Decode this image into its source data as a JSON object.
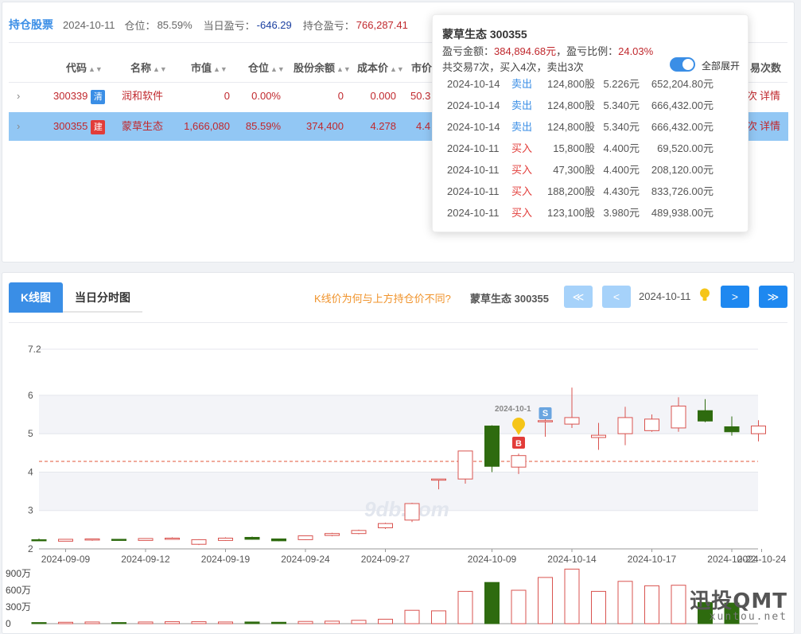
{
  "summary": {
    "title": "持仓股票",
    "date": "2024-10-11",
    "position_label": "仓位：",
    "position_value": "85.59%",
    "daily_pl_label": "当日盈亏：",
    "daily_pl_value": "-646.29",
    "hold_pl_label": "持仓盈亏：",
    "hold_pl_value": "766,287.41"
  },
  "table": {
    "headers": {
      "code": "代码",
      "name": "名称",
      "mktval": "市值",
      "pos": "仓位",
      "shares": "股份余额",
      "cost": "成本价",
      "price": "市价",
      "trades": "易次数"
    },
    "rows": [
      {
        "expand": "›",
        "code": "300339",
        "tag": "清",
        "name": "润和软件",
        "mktval": "0",
        "pos": "0.00%",
        "shares": "0",
        "cost": "0.000",
        "price": "50.3",
        "x": "次",
        "detail": "详情"
      },
      {
        "expand": "›",
        "code": "300355",
        "tag": "建",
        "name": "蒙草生态",
        "mktval": "1,666,080",
        "pos": "85.59%",
        "shares": "374,400",
        "cost": "4.278",
        "price": "4.4",
        "x": "次",
        "detail": "详情"
      }
    ]
  },
  "tooltip": {
    "title": "蒙草生态 300355",
    "pl_label": "盈亏金额：",
    "pl_value": "384,894.68元",
    "pl_sep": "，盈亏比例：",
    "pl_ratio": "24.03%",
    "count_text": "共交易7次，买入4次，卖出3次",
    "expand_all": "全部展开",
    "trades": [
      {
        "date": "2024-10-14",
        "type": "卖出",
        "qty": "124,800股",
        "price": "5.226元",
        "amount": "652,204.80元",
        "side": "sell"
      },
      {
        "date": "2024-10-14",
        "type": "卖出",
        "qty": "124,800股",
        "price": "5.340元",
        "amount": "666,432.00元",
        "side": "sell"
      },
      {
        "date": "2024-10-14",
        "type": "卖出",
        "qty": "124,800股",
        "price": "5.340元",
        "amount": "666,432.00元",
        "side": "sell"
      },
      {
        "date": "2024-10-11",
        "type": "买入",
        "qty": "15,800股",
        "price": "4.400元",
        "amount": "69,520.00元",
        "side": "buy"
      },
      {
        "date": "2024-10-11",
        "type": "买入",
        "qty": "47,300股",
        "price": "4.400元",
        "amount": "208,120.00元",
        "side": "buy"
      },
      {
        "date": "2024-10-11",
        "type": "买入",
        "qty": "188,200股",
        "price": "4.430元",
        "amount": "833,726.00元",
        "side": "buy"
      },
      {
        "date": "2024-10-11",
        "type": "买入",
        "qty": "123,100股",
        "price": "3.980元",
        "amount": "489,938.00元",
        "side": "buy"
      }
    ]
  },
  "kline_panel": {
    "tab_k": "K线图",
    "tab_t": "当日分时图",
    "hint": "K线价为何与上方持仓价不同?",
    "stock": "蒙草生态 300355",
    "nav_first": "≪",
    "nav_prev": "<",
    "nav_date": "2024-10-11",
    "nav_next": ">",
    "nav_last": "≫"
  },
  "chart_data": {
    "type": "candlestick",
    "y_ticks": [
      "7.2",
      "6",
      "5",
      "4",
      "3",
      "2"
    ],
    "ylim": [
      2,
      7.2
    ],
    "x_ticks": [
      "2024-09-09",
      "2024-09-12",
      "2024-09-19",
      "2024-09-24",
      "2024-09-27",
      "2024-10-09",
      "2024-10-14",
      "2024-10-17",
      "2024-10-22",
      "2024-10-24"
    ],
    "cost_line": 4.278,
    "candles": [
      {
        "o": 2.24,
        "h": 2.27,
        "l": 2.22,
        "c": 2.24,
        "up": false
      },
      {
        "o": 2.2,
        "h": 2.25,
        "l": 2.2,
        "c": 2.25,
        "up": true
      },
      {
        "o": 2.23,
        "h": 2.26,
        "l": 2.21,
        "c": 2.26,
        "up": true
      },
      {
        "o": 2.25,
        "h": 2.26,
        "l": 2.23,
        "c": 2.24,
        "up": false
      },
      {
        "o": 2.22,
        "h": 2.28,
        "l": 2.22,
        "c": 2.27,
        "up": true
      },
      {
        "o": 2.27,
        "h": 2.3,
        "l": 2.25,
        "c": 2.28,
        "up": true
      },
      {
        "o": 2.12,
        "h": 2.25,
        "l": 2.1,
        "c": 2.24,
        "up": true
      },
      {
        "o": 2.22,
        "h": 2.3,
        "l": 2.21,
        "c": 2.28,
        "up": true
      },
      {
        "o": 2.3,
        "h": 2.32,
        "l": 2.24,
        "c": 2.25,
        "up": false
      },
      {
        "o": 2.26,
        "h": 2.27,
        "l": 2.2,
        "c": 2.21,
        "up": false
      },
      {
        "o": 2.24,
        "h": 2.34,
        "l": 2.23,
        "c": 2.34,
        "up": true
      },
      {
        "o": 2.35,
        "h": 2.42,
        "l": 2.33,
        "c": 2.4,
        "up": true
      },
      {
        "o": 2.4,
        "h": 2.5,
        "l": 2.38,
        "c": 2.48,
        "up": true
      },
      {
        "o": 2.55,
        "h": 2.68,
        "l": 2.52,
        "c": 2.66,
        "up": true
      },
      {
        "o": 2.75,
        "h": 3.2,
        "l": 2.7,
        "c": 3.18,
        "up": true
      },
      {
        "o": 3.82,
        "h": 3.82,
        "l": 3.55,
        "c": 3.8,
        "up": true
      },
      {
        "o": 3.82,
        "h": 4.55,
        "l": 3.7,
        "c": 4.55,
        "up": true
      },
      {
        "o": 5.2,
        "h": 5.22,
        "l": 4.0,
        "c": 4.15,
        "up": false
      },
      {
        "o": 4.13,
        "h": 4.48,
        "l": 3.95,
        "c": 4.43,
        "up": true
      },
      {
        "o": 5.34,
        "h": 5.5,
        "l": 4.92,
        "c": 5.34,
        "up": true
      },
      {
        "o": 5.25,
        "h": 6.2,
        "l": 5.15,
        "c": 5.42,
        "up": true
      },
      {
        "o": 4.9,
        "h": 5.28,
        "l": 4.58,
        "c": 4.96,
        "up": true
      },
      {
        "o": 5.0,
        "h": 5.7,
        "l": 4.7,
        "c": 5.42,
        "up": true
      },
      {
        "o": 5.08,
        "h": 5.5,
        "l": 5.05,
        "c": 5.38,
        "up": true
      },
      {
        "o": 5.15,
        "h": 5.95,
        "l": 5.05,
        "c": 5.72,
        "up": true
      },
      {
        "o": 5.6,
        "h": 5.9,
        "l": 5.3,
        "c": 5.33,
        "up": false
      },
      {
        "o": 5.18,
        "h": 5.45,
        "l": 4.95,
        "c": 5.05,
        "up": false
      },
      {
        "o": 5.0,
        "h": 5.35,
        "l": 4.8,
        "c": 5.2,
        "up": true
      }
    ],
    "volume_ticks": [
      "900万",
      "600万",
      "300万",
      "0"
    ],
    "volume_max": 900,
    "volumes": [
      20,
      25,
      30,
      20,
      30,
      35,
      35,
      30,
      30,
      25,
      40,
      45,
      60,
      80,
      240,
      230,
      580,
      740,
      600,
      830,
      980,
      580,
      760,
      680,
      690,
      380,
      370,
      0
    ],
    "markers": {
      "buy_label": "B",
      "sell_label": "S",
      "date_label": "2024-10-1",
      "buy_index": 18,
      "sell_index": 19
    },
    "watermark": "9db.com"
  },
  "brand": {
    "name": "迅投QMT",
    "url": "xuntou.net"
  }
}
